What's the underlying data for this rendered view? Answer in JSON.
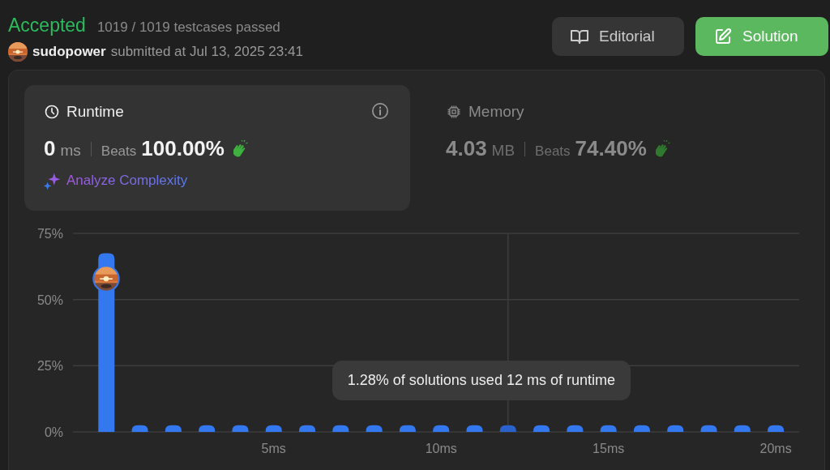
{
  "header": {
    "status": "Accepted",
    "testcases": "1019 / 1019 testcases passed",
    "user": "sudopower",
    "submitted": "submitted at Jul 13, 2025 23:41"
  },
  "buttons": [
    {
      "label": "Editorial",
      "kind": "secondary"
    },
    {
      "label": "Solution",
      "kind": "primary"
    }
  ],
  "metrics": [
    {
      "kind": "runtime",
      "title": "Runtime",
      "selected": true,
      "value": "0",
      "unit": "ms",
      "beats_label": "Beats",
      "beats": "100.00%",
      "link": "Analyze Complexity"
    },
    {
      "kind": "memory",
      "title": "Memory",
      "selected": false,
      "value": "4.03",
      "unit": "MB",
      "beats_label": "Beats",
      "beats": "74.40%"
    }
  ],
  "chart": {
    "chart_data": {
      "type": "bar",
      "x": [
        0,
        1,
        2,
        3,
        4,
        5,
        6,
        7,
        8,
        9,
        10,
        11,
        12,
        13,
        14,
        15,
        16,
        17,
        18,
        19,
        20
      ],
      "values": [
        67.5,
        2.5,
        2.5,
        2.5,
        2.5,
        2.5,
        2.5,
        2.5,
        2.5,
        2.5,
        2.5,
        2.5,
        2.5,
        2.5,
        2.5,
        2.5,
        2.5,
        2.5,
        2.5,
        2.5,
        2.5
      ],
      "ylim": [
        0,
        75
      ],
      "xlim": [
        -1,
        20.7
      ],
      "yticks": [
        {
          "value": 0,
          "label": "0%"
        },
        {
          "value": 25,
          "label": "25%"
        },
        {
          "value": 50,
          "label": "50%"
        },
        {
          "value": 75,
          "label": "75%"
        }
      ],
      "xticks": [
        {
          "value": 5,
          "label": "5ms"
        },
        {
          "value": 10,
          "label": "10ms"
        },
        {
          "value": 15,
          "label": "15ms"
        },
        {
          "value": 20,
          "label": "20ms"
        }
      ],
      "annotations": [
        "1.28% of solutions used 12 ms of runtime"
      ]
    },
    "bars": [
      {
        "hovered": false,
        "mine": true
      },
      {
        "hovered": false,
        "mine": false
      },
      {
        "hovered": false,
        "mine": false
      },
      {
        "hovered": false,
        "mine": false
      },
      {
        "hovered": false,
        "mine": false
      },
      {
        "hovered": false,
        "mine": false
      },
      {
        "hovered": false,
        "mine": false
      },
      {
        "hovered": false,
        "mine": false
      },
      {
        "hovered": false,
        "mine": false
      },
      {
        "hovered": false,
        "mine": false
      },
      {
        "hovered": false,
        "mine": false
      },
      {
        "hovered": false,
        "mine": false
      },
      {
        "hovered": true,
        "mine": false
      },
      {
        "hovered": false,
        "mine": false
      },
      {
        "hovered": false,
        "mine": false
      },
      {
        "hovered": false,
        "mine": false
      },
      {
        "hovered": false,
        "mine": false
      },
      {
        "hovered": false,
        "mine": false
      },
      {
        "hovered": false,
        "mine": false
      },
      {
        "hovered": false,
        "mine": false
      },
      {
        "hovered": false,
        "mine": false
      }
    ]
  }
}
